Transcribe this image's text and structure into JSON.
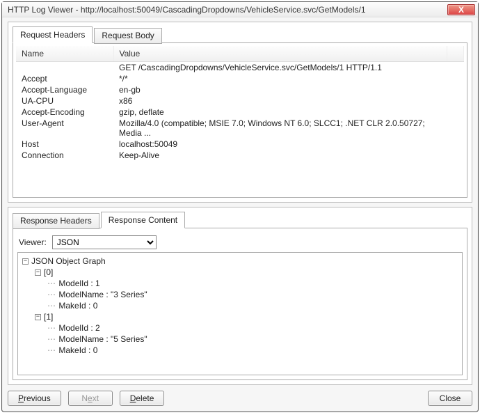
{
  "window": {
    "title": "HTTP Log Viewer - http://localhost:50049/CascadingDropdowns/VehicleService.svc/GetModels/1",
    "close_symbol": "X"
  },
  "tabs_top": {
    "request_headers": "Request Headers",
    "request_body": "Request Body"
  },
  "headers_table": {
    "col_name": "Name",
    "col_value": "Value",
    "rows": [
      {
        "name": "",
        "value": "GET /CascadingDropdowns/VehicleService.svc/GetModels/1 HTTP/1.1"
      },
      {
        "name": "Accept",
        "value": "*/*"
      },
      {
        "name": "Accept-Language",
        "value": "en-gb"
      },
      {
        "name": "UA-CPU",
        "value": "x86"
      },
      {
        "name": "Accept-Encoding",
        "value": "gzip, deflate"
      },
      {
        "name": "User-Agent",
        "value": "Mozilla/4.0 (compatible; MSIE 7.0; Windows NT 6.0; SLCC1; .NET CLR 2.0.50727; Media ..."
      },
      {
        "name": "Host",
        "value": "localhost:50049"
      },
      {
        "name": "Connection",
        "value": "Keep-Alive"
      }
    ]
  },
  "tabs_bottom": {
    "response_headers": "Response Headers",
    "response_content": "Response Content"
  },
  "viewer": {
    "label": "Viewer:",
    "selected": "JSON"
  },
  "tree": {
    "root": "JSON Object Graph",
    "items": [
      {
        "index": "[0]",
        "props": [
          "ModelId : 1",
          "ModelName : \"3 Series\"",
          "MakeId : 0"
        ]
      },
      {
        "index": "[1]",
        "props": [
          "ModelId : 2",
          "ModelName : \"5 Series\"",
          "MakeId : 0"
        ]
      }
    ]
  },
  "buttons": {
    "previous": "Previous",
    "next": "Next",
    "delete": "Delete",
    "close": "Close"
  }
}
